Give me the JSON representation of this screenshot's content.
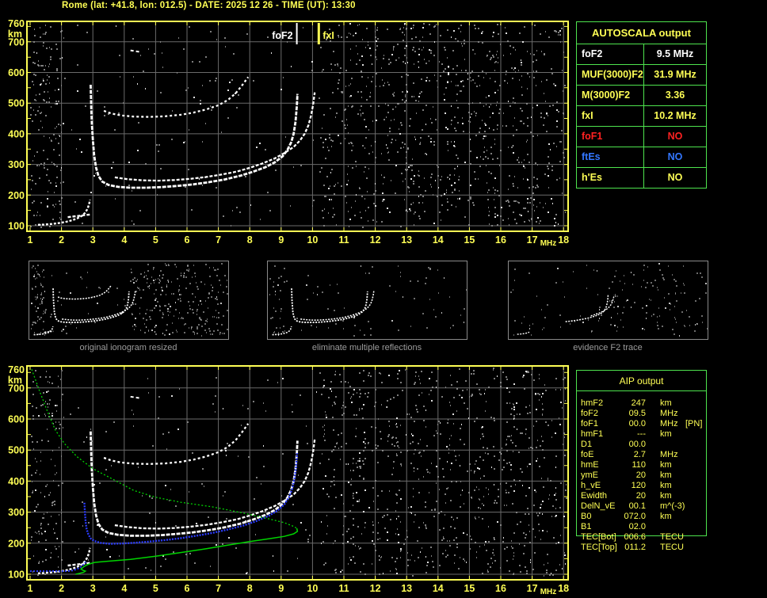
{
  "title": "Rome (lat: +41.8, lon: 012.5) - DATE: 2025 12 26 - TIME (UT): 13:30",
  "colors": {
    "accent_yellow": "#ffff55",
    "table_border_green": "#4ee44e",
    "status_red": "#ff2222",
    "status_blue": "#3377ff",
    "white": "#ffffff",
    "caption_gray": "#9c9c9c",
    "grid_gray": "#6b6b6b",
    "noise_gray": "#8f8f8f",
    "profile_green": "#00d400",
    "restored_trace_blue": "#2b3cff"
  },
  "autoscala_table": {
    "header": "AUTOSCALA output",
    "rows": [
      {
        "label": "foF2",
        "value": "9.5 MHz",
        "color": "white"
      },
      {
        "label": "MUF(3000)F2",
        "value": "31.9 MHz",
        "color": "yellow"
      },
      {
        "label": "M(3000)F2",
        "value": "3.36",
        "color": "yellow"
      },
      {
        "label": "fxI",
        "value": "10.2 MHz",
        "color": "yellow"
      },
      {
        "label": "foF1",
        "value": "NO",
        "color": "red"
      },
      {
        "label": "ftEs",
        "value": "NO",
        "color": "blue"
      },
      {
        "label": "h'Es",
        "value": "NO",
        "color": "yellow"
      }
    ]
  },
  "aip_table": {
    "header": "AIP output",
    "rows": [
      {
        "name": "hmF2",
        "value": "247",
        "unit": "km",
        "note": ""
      },
      {
        "name": "foF2",
        "value": "09.5",
        "unit": "MHz",
        "note": ""
      },
      {
        "name": "foF1",
        "value": "00.0",
        "unit": "MHz",
        "note": "[PN]"
      },
      {
        "name": "hmF1",
        "value": "---",
        "unit": "km",
        "note": ""
      },
      {
        "name": "D1",
        "value": "00.0",
        "unit": "",
        "note": ""
      },
      {
        "name": "foE",
        "value": "2.7",
        "unit": "MHz",
        "note": ""
      },
      {
        "name": "hmE",
        "value": "110",
        "unit": "km",
        "note": ""
      },
      {
        "name": "ymE",
        "value": "20",
        "unit": "km",
        "note": ""
      },
      {
        "name": "h_vE",
        "value": "120",
        "unit": "km",
        "note": ""
      },
      {
        "name": "Ewidth",
        "value": "20",
        "unit": "km",
        "note": ""
      },
      {
        "name": "DelN_vE",
        "value": "00.1",
        "unit": "m^(-3)",
        "note": ""
      },
      {
        "name": "B0",
        "value": "072.0",
        "unit": "km",
        "note": ""
      },
      {
        "name": "B1",
        "value": "02.0",
        "unit": "",
        "note": ""
      },
      {
        "name": "TEC[Bot]",
        "value": "006.6",
        "unit": "TECU",
        "note": ""
      },
      {
        "name": "TEC[Top]",
        "value": "011.2",
        "unit": "TECU",
        "note": ""
      }
    ]
  },
  "thumbnails": [
    {
      "caption": "original ionogram resized",
      "traces": [
        "E",
        "E_blob",
        "O",
        "X",
        "hop2"
      ],
      "noise": "dense"
    },
    {
      "caption": "eliminate multiple reflections",
      "traces": [
        "E",
        "O",
        "X"
      ],
      "noise": "sparse"
    },
    {
      "caption": "evidence F2 trace",
      "traces": [
        "E_short",
        "F2rise",
        "Xrise"
      ],
      "noise": "medium"
    }
  ],
  "chart_data": {
    "plots": [
      {
        "id": "top_ionogram",
        "type": "scatter",
        "title": "scaled ionogram with AUTOSCALA markers",
        "xlabel": "MHz",
        "ylabel": "km",
        "xlim": [
          1,
          18
        ],
        "ylim": [
          100,
          760
        ],
        "x_ticks": [
          1,
          2,
          3,
          4,
          5,
          6,
          7,
          8,
          9,
          10,
          11,
          12,
          13,
          14,
          15,
          16,
          17,
          18
        ],
        "y_ticks": [
          760,
          700,
          600,
          500,
          400,
          300,
          200,
          100
        ],
        "grid": true,
        "markers": [
          {
            "name": "foF2",
            "mhz": 9.5,
            "color": "#ffffff"
          },
          {
            "name": "fxI",
            "mhz": 10.2,
            "color": "#ffff55"
          }
        ],
        "traces": [
          "E",
          "E_blob",
          "O",
          "X",
          "hop2",
          "dash_high"
        ]
      },
      {
        "id": "bottom_ionogram",
        "type": "scatter",
        "title": "ionogram with restored F2 trace and electron density profile",
        "xlabel": "MHz",
        "ylabel": "km",
        "xlim": [
          1,
          18
        ],
        "ylim": [
          100,
          760
        ],
        "x_ticks": [
          1,
          2,
          3,
          4,
          5,
          6,
          7,
          8,
          9,
          10,
          11,
          12,
          13,
          14,
          15,
          16,
          17,
          18
        ],
        "y_ticks": [
          760,
          700,
          600,
          500,
          400,
          300,
          200,
          100
        ],
        "grid": true,
        "markers": [],
        "traces": [
          "E",
          "E_blob",
          "O",
          "X",
          "hop2",
          "dash_high",
          "blue_E",
          "blue_trace",
          "green_top",
          "green_bottom"
        ]
      }
    ],
    "traces": {
      "E": {
        "color": "#ffffff",
        "width": 2.4,
        "dash": "3,2",
        "points": [
          [
            1.25,
            103
          ],
          [
            1.45,
            104
          ],
          [
            1.7,
            106
          ],
          [
            1.95,
            109
          ],
          [
            2.15,
            113
          ],
          [
            2.35,
            118
          ],
          [
            2.5,
            124
          ],
          [
            2.65,
            132
          ],
          [
            2.75,
            142
          ],
          [
            2.83,
            155
          ],
          [
            2.88,
            170
          ],
          [
            2.91,
            185
          ]
        ]
      },
      "E_blob": {
        "color": "#ffffff",
        "width": 2.4,
        "dash": "4,2",
        "points": [
          [
            2.2,
            128
          ],
          [
            2.45,
            131
          ],
          [
            2.7,
            134
          ],
          [
            2.95,
            137
          ]
        ]
      },
      "O": {
        "color": "#ffffff",
        "width": 2.8,
        "dash": "5,1.5",
        "points": [
          [
            2.93,
            560
          ],
          [
            2.94,
            520
          ],
          [
            2.95,
            480
          ],
          [
            2.97,
            430
          ],
          [
            3.0,
            380
          ],
          [
            3.04,
            330
          ],
          [
            3.1,
            290
          ],
          [
            3.18,
            262
          ],
          [
            3.3,
            244
          ],
          [
            3.5,
            233
          ],
          [
            3.8,
            227
          ],
          [
            4.2,
            224
          ],
          [
            4.7,
            224
          ],
          [
            5.2,
            226
          ],
          [
            5.7,
            230
          ],
          [
            6.2,
            235
          ],
          [
            6.7,
            242
          ],
          [
            7.2,
            251
          ],
          [
            7.7,
            263
          ],
          [
            8.1,
            276
          ],
          [
            8.5,
            291
          ],
          [
            8.8,
            307
          ],
          [
            9.05,
            327
          ],
          [
            9.2,
            347
          ],
          [
            9.32,
            372
          ],
          [
            9.4,
            400
          ],
          [
            9.46,
            440
          ],
          [
            9.5,
            490
          ],
          [
            9.52,
            530
          ]
        ]
      },
      "X": {
        "color": "#ffffff",
        "width": 2.3,
        "dash": "4,2",
        "points": [
          [
            3.7,
            258
          ],
          [
            4.1,
            252
          ],
          [
            4.6,
            248
          ],
          [
            5.1,
            247
          ],
          [
            5.6,
            249
          ],
          [
            6.1,
            253
          ],
          [
            6.6,
            259
          ],
          [
            7.1,
            267
          ],
          [
            7.6,
            277
          ],
          [
            8.0,
            289
          ],
          [
            8.4,
            303
          ],
          [
            8.8,
            320
          ],
          [
            9.1,
            337
          ],
          [
            9.4,
            357
          ],
          [
            9.6,
            378
          ],
          [
            9.75,
            400
          ],
          [
            9.87,
            428
          ],
          [
            9.95,
            458
          ],
          [
            10.02,
            495
          ],
          [
            10.07,
            535
          ]
        ]
      },
      "hop2": {
        "color": "#ffffff",
        "width": 2.3,
        "dash": "3,3",
        "points": [
          [
            3.35,
            475
          ],
          [
            3.6,
            466
          ],
          [
            3.9,
            460
          ],
          [
            4.3,
            456
          ],
          [
            4.8,
            455
          ],
          [
            5.3,
            457
          ],
          [
            5.8,
            462
          ],
          [
            6.2,
            469
          ],
          [
            6.6,
            479
          ],
          [
            7.0,
            493
          ],
          [
            7.3,
            510
          ],
          [
            7.55,
            532
          ],
          [
            7.75,
            557
          ],
          [
            7.95,
            585
          ]
        ]
      },
      "dash_high": {
        "color": "#ffffff",
        "width": 2,
        "dash": "4,3",
        "points": [
          [
            4.2,
            672
          ],
          [
            4.5,
            667
          ]
        ]
      },
      "blue_E": {
        "color": "#2b3cff",
        "width": 2,
        "dash": "2,2",
        "points": [
          [
            1.0,
            110
          ],
          [
            1.4,
            110
          ],
          [
            1.8,
            110
          ],
          [
            2.2,
            110
          ],
          [
            2.35,
            112
          ],
          [
            2.5,
            117
          ],
          [
            2.62,
            124
          ],
          [
            2.72,
            133
          ],
          [
            2.8,
            144
          ]
        ]
      },
      "blue_trace": {
        "color": "#2b3cff",
        "width": 2.4,
        "dash": "2,1.5",
        "points": [
          [
            2.73,
            330
          ],
          [
            2.75,
            295
          ],
          [
            2.77,
            268
          ],
          [
            2.8,
            246
          ],
          [
            2.85,
            230
          ],
          [
            2.92,
            216
          ],
          [
            3.05,
            207
          ],
          [
            3.25,
            201
          ],
          [
            3.55,
            198
          ],
          [
            3.9,
            199
          ],
          [
            4.3,
            201
          ],
          [
            4.8,
            205
          ],
          [
            5.3,
            210
          ],
          [
            5.8,
            216
          ],
          [
            6.3,
            224
          ],
          [
            6.8,
            233
          ],
          [
            7.3,
            244
          ],
          [
            7.8,
            257
          ],
          [
            8.2,
            271
          ],
          [
            8.6,
            288
          ],
          [
            8.9,
            306
          ],
          [
            9.1,
            325
          ],
          [
            9.25,
            348
          ],
          [
            9.35,
            375
          ],
          [
            9.43,
            410
          ],
          [
            9.48,
            450
          ],
          [
            9.51,
            490
          ]
        ]
      },
      "green_top": {
        "color": "#00d400",
        "width": 1.3,
        "dash": "2,2.5",
        "points": [
          [
            1.05,
            760
          ],
          [
            1.3,
            690
          ],
          [
            1.55,
            625
          ],
          [
            1.8,
            565
          ],
          [
            2.1,
            520
          ],
          [
            2.5,
            478
          ],
          [
            3.0,
            440
          ],
          [
            3.6,
            408
          ],
          [
            4.3,
            370
          ],
          [
            5.0,
            348
          ],
          [
            5.8,
            332
          ],
          [
            6.8,
            317
          ],
          [
            7.8,
            297
          ],
          [
            8.5,
            281
          ],
          [
            9.1,
            266
          ],
          [
            9.4,
            254
          ],
          [
            9.5,
            248
          ]
        ]
      },
      "green_bottom": {
        "color": "#00d400",
        "width": 1.5,
        "dash": "",
        "points": [
          [
            9.5,
            248
          ],
          [
            9.52,
            238
          ],
          [
            9.4,
            230
          ],
          [
            9.1,
            222
          ],
          [
            8.6,
            214
          ],
          [
            8.0,
            205
          ],
          [
            7.3,
            194
          ],
          [
            6.6,
            182
          ],
          [
            5.8,
            170
          ],
          [
            5.0,
            158
          ],
          [
            4.2,
            148
          ],
          [
            3.5,
            142
          ],
          [
            3.05,
            138
          ],
          [
            2.85,
            132
          ],
          [
            2.72,
            125
          ],
          [
            2.62,
            117
          ],
          [
            2.68,
            113
          ],
          [
            2.76,
            110
          ],
          [
            2.7,
            106
          ],
          [
            2.58,
            103
          ],
          [
            2.45,
            100
          ]
        ]
      },
      "E_short": {
        "color": "#ffffff",
        "width": 2,
        "dash": "3,2",
        "points": [
          [
            1.6,
            107
          ],
          [
            1.9,
            110
          ],
          [
            2.2,
            114
          ],
          [
            2.5,
            121
          ],
          [
            2.65,
            130
          ]
        ]
      },
      "F2rise": {
        "color": "#ffffff",
        "width": 2.3,
        "dash": "4,2",
        "points": [
          [
            5.8,
            232
          ],
          [
            6.3,
            238
          ],
          [
            6.8,
            246
          ],
          [
            7.3,
            256
          ],
          [
            7.8,
            268
          ],
          [
            8.2,
            281
          ],
          [
            8.6,
            297
          ],
          [
            8.9,
            315
          ],
          [
            9.1,
            333
          ],
          [
            9.25,
            355
          ],
          [
            9.35,
            382
          ],
          [
            9.43,
            420
          ],
          [
            9.48,
            465
          ],
          [
            9.5,
            505
          ]
        ]
      },
      "Xrise": {
        "color": "#ffffff",
        "width": 2,
        "dash": "3,2",
        "points": [
          [
            8.0,
            289
          ],
          [
            8.4,
            303
          ],
          [
            8.8,
            320
          ],
          [
            9.1,
            337
          ],
          [
            9.4,
            357
          ],
          [
            9.6,
            378
          ],
          [
            9.75,
            400
          ],
          [
            9.87,
            428
          ],
          [
            9.95,
            458
          ],
          [
            10.02,
            492
          ]
        ]
      }
    }
  }
}
